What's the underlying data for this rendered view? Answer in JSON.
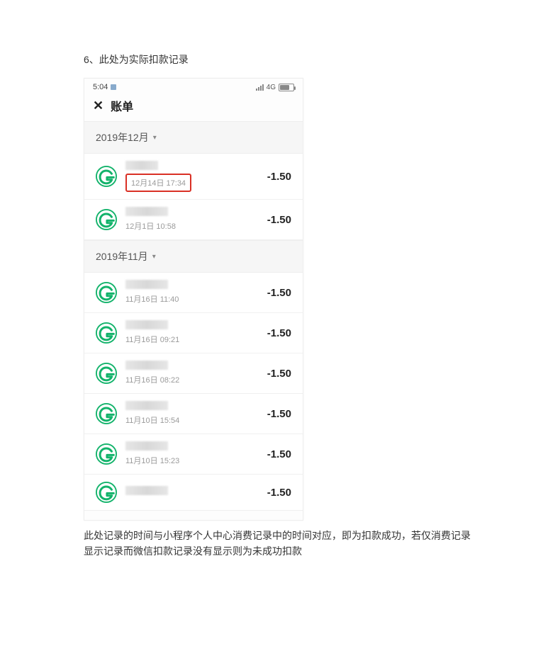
{
  "captions": {
    "top": "6、此处为实际扣款记录",
    "bottom": "此处记录的时间与小程序个人中心消费记录中的时间对应，即为扣款成功，若仅消费记录显示记录而微信扣款记录没有显示则为未成功扣款"
  },
  "status_bar": {
    "time": "5:04",
    "network": "4G"
  },
  "nav": {
    "close_glyph": "✕",
    "title": "账单"
  },
  "sections": [
    {
      "month_label": "2019年12月",
      "rows": [
        {
          "time": "12月14日 17:34",
          "amount": "-1.50",
          "highlight": true
        },
        {
          "time": "12月1日 10:58",
          "amount": "-1.50",
          "highlight": false
        }
      ]
    },
    {
      "month_label": "2019年11月",
      "rows": [
        {
          "time": "11月16日 11:40",
          "amount": "-1.50",
          "highlight": false
        },
        {
          "time": "11月16日 09:21",
          "amount": "-1.50",
          "highlight": false
        },
        {
          "time": "11月16日 08:22",
          "amount": "-1.50",
          "highlight": false
        },
        {
          "time": "11月10日 15:54",
          "amount": "-1.50",
          "highlight": false
        },
        {
          "time": "11月10日 15:23",
          "amount": "-1.50",
          "highlight": false
        },
        {
          "time": "",
          "amount": "-1.50",
          "highlight": false
        }
      ]
    }
  ],
  "icon": {
    "merchant": "g-logo-icon"
  }
}
